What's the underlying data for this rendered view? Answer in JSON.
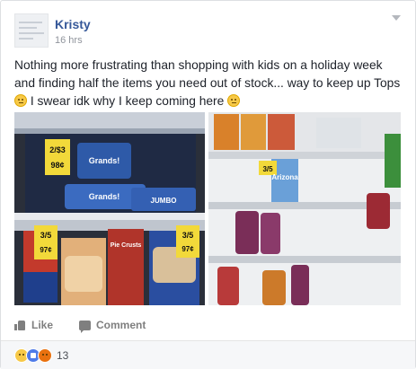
{
  "post": {
    "author": "Kristy",
    "time": "16 hrs",
    "text_parts": [
      "Nothing more frustrating than shopping with kids on a holiday week and finding half the items you need out of stock... way to keep up Tops ",
      " I swear idk why I keep coming here "
    ],
    "emoji_icons": [
      "sad-face-emoji-icon",
      "sad-face-emoji-icon"
    ]
  },
  "photos": {
    "left": {
      "shelf_prices": [
        "2/$3",
        "98¢",
        "3/5",
        "97¢",
        "3/5",
        "97¢"
      ],
      "product_labels": [
        "Grands!",
        "Grands!",
        "JUMBO",
        "Pie Crusts"
      ],
      "description": ""
    },
    "right": {
      "shelf_prices": [
        "3/5"
      ],
      "product_labels": [
        "Arizona"
      ]
    }
  },
  "actions": {
    "like_label": "Like",
    "comment_label": "Comment"
  },
  "footer": {
    "reaction_icons": [
      "sad-reaction-icon",
      "like-reaction-icon",
      "angry-reaction-icon"
    ],
    "reaction_count": "13"
  },
  "colors": {
    "author": "#365899",
    "text": "#1d2129",
    "meta": "#90949c",
    "footer_bg": "#f6f7f9"
  }
}
